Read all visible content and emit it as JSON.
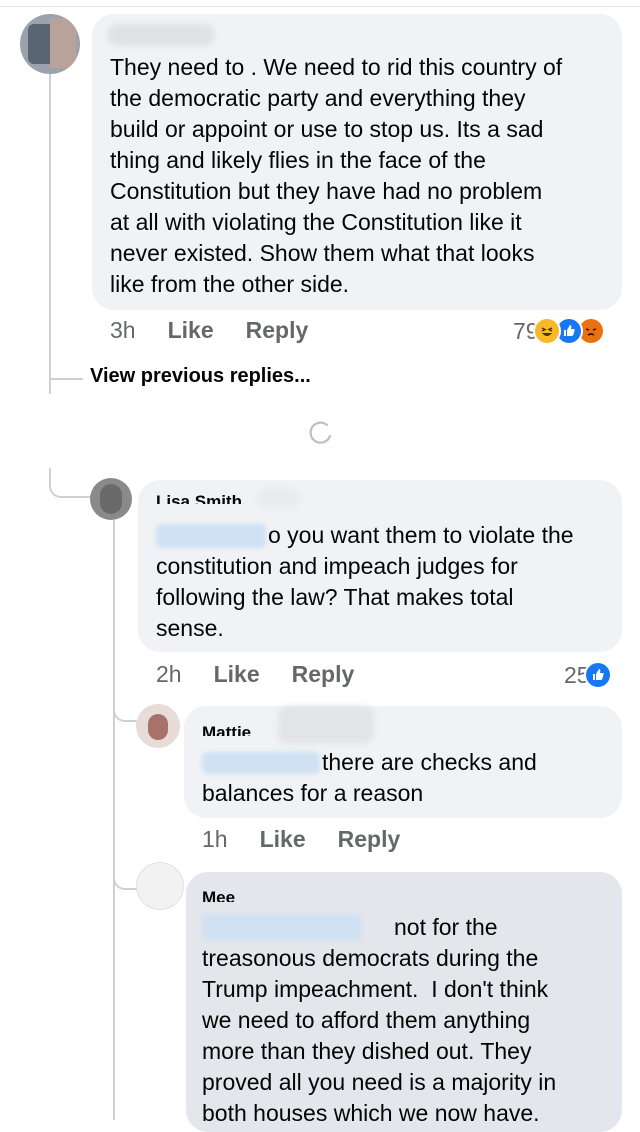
{
  "comments": [
    {
      "time": "3h",
      "like_label": "Like",
      "reply_label": "Reply",
      "text": "They need to . We need to rid this country of\nthe democratic party and everything they\nbuild or appoint or use to stop us. Its a sad\nthing and likely flies in the face of the\nConstitution but they have had no problem\nat all with violating the Constitution like it\nnever existed. Show them what that looks\nlike from the other side.",
      "reaction_count": "79",
      "reactions": [
        "haha-icon",
        "like-icon",
        "angry-icon"
      ]
    },
    {
      "name": "Lisa Smith",
      "text_prefix": "o you want them to violate the",
      "text_rest": "constitution and impeach judges for\nfollowing the law? That makes total\nsense.",
      "time": "2h",
      "like_label": "Like",
      "reply_label": "Reply",
      "reaction_count": "25",
      "reactions": [
        "like-icon"
      ]
    },
    {
      "name": "Mattie",
      "text_suffix": "there are checks and",
      "text_rest": "balances for a reason",
      "time": "1h",
      "like_label": "Like",
      "reply_label": "Reply"
    },
    {
      "name": "Mee",
      "text_suffix": "not for the",
      "text_rest": "treasonous democrats during the\nTrump impeachment.  I don't think\nwe need to afford them anything\nmore than they dished out. They\nproved all you need is a majority in\nboth houses which we now have."
    }
  ],
  "view_previous_label": "View previous replies...",
  "colors": {
    "bubble": "#f0f2f5",
    "bubble_dark": "#e4e6eb",
    "like_blue": "#1877f2",
    "haha_yellow": "#f7b928",
    "angry_orange": "#e9710f"
  }
}
